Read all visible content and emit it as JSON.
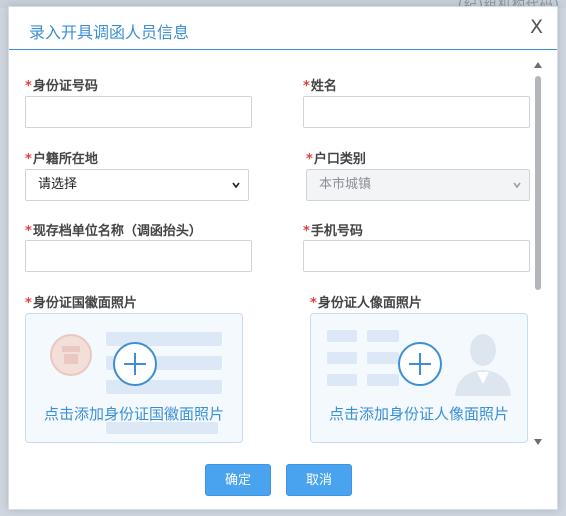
{
  "backdrop": {
    "partial_text": "(纪)组机构代码)"
  },
  "dialog": {
    "title": "录入开具调函人员信息",
    "close_label": "X"
  },
  "form": {
    "id_number": {
      "required_mark": "*",
      "label": "身份证号码",
      "value": ""
    },
    "name": {
      "required_mark": "*",
      "label": "姓名",
      "value": ""
    },
    "household_location": {
      "required_mark": "*",
      "label": "户籍所在地",
      "selected": "请选择"
    },
    "household_type": {
      "required_mark": "*",
      "label": "户口类别",
      "selected": "本市城镇",
      "disabled": true
    },
    "archive_unit": {
      "required_mark": "*",
      "label": "现存档单位名称（调函抬头）",
      "value": ""
    },
    "phone": {
      "required_mark": "*",
      "label": "手机号码",
      "value": ""
    },
    "id_emblem_photo": {
      "required_mark": "*",
      "label": "身份证国徽面照片",
      "upload_text": "点击添加身份证国徽面照片"
    },
    "id_portrait_photo": {
      "required_mark": "*",
      "label": "身份证人像面照片",
      "upload_text": "点击添加身份证人像面照片"
    }
  },
  "buttons": {
    "confirm": "确定",
    "cancel": "取消"
  },
  "colors": {
    "accent": "#3a8fd6",
    "required": "#e43d3d",
    "button": "#4aa3ef"
  }
}
